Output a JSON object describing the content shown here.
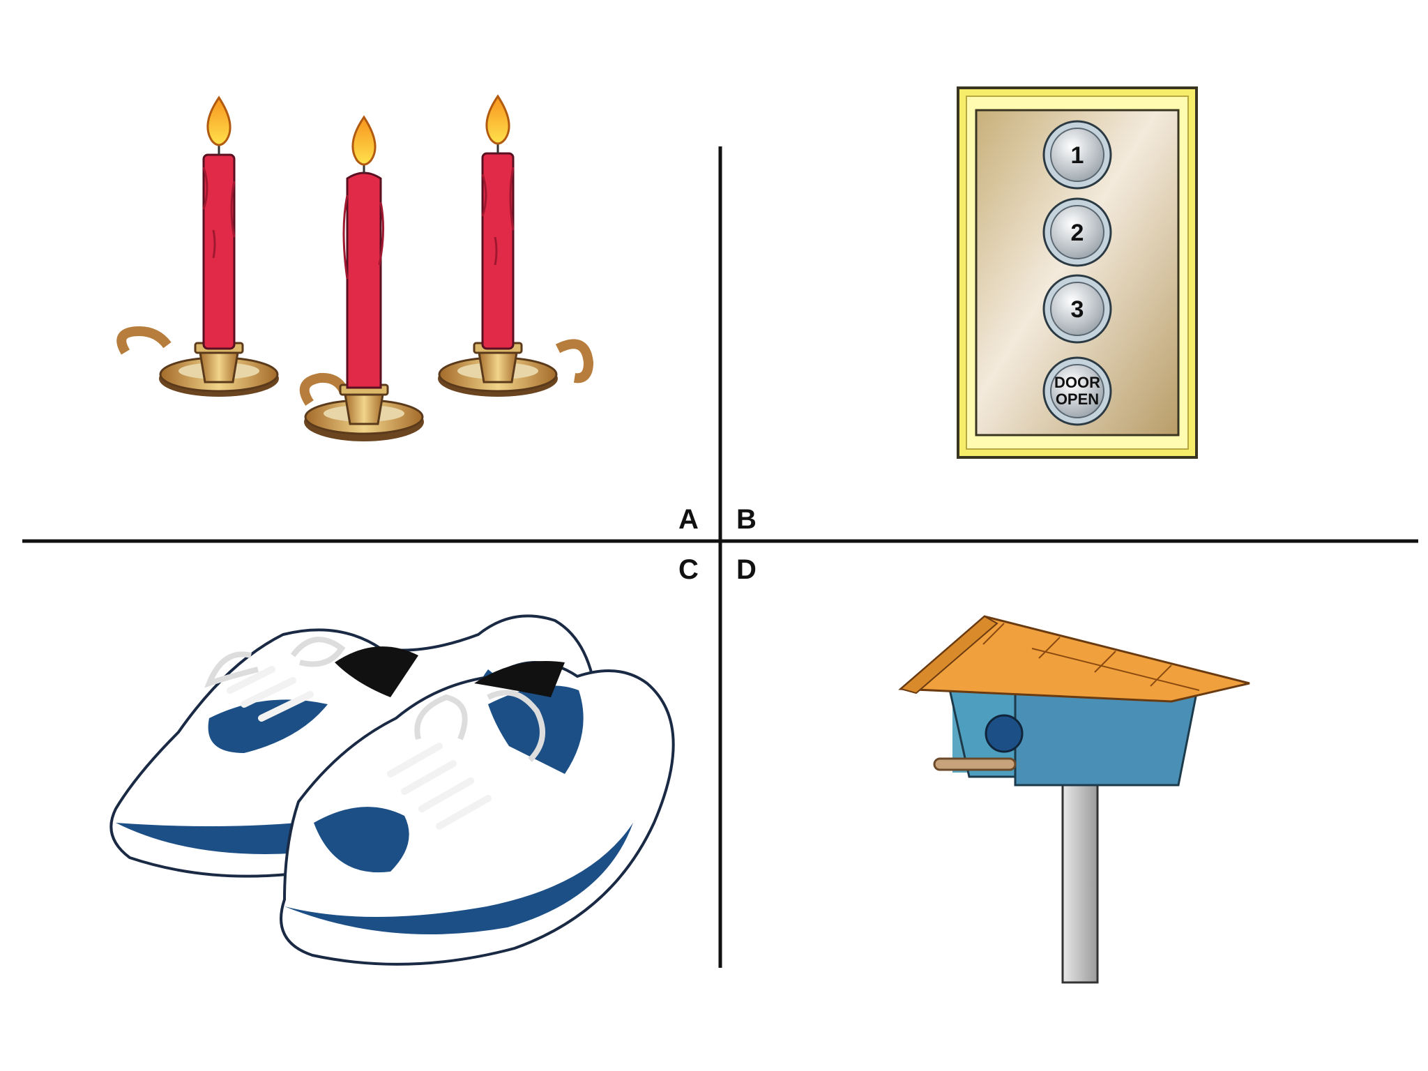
{
  "quadrants": [
    {
      "label": "A",
      "picture": "candles-in-holders"
    },
    {
      "label": "B",
      "picture": "elevator-button-panel"
    },
    {
      "label": "C",
      "picture": "sneakers"
    },
    {
      "label": "D",
      "picture": "birdhouse"
    }
  ],
  "elevator_panel": {
    "buttons": [
      "1",
      "2",
      "3"
    ],
    "door_open_line1": "DOOR",
    "door_open_line2": "OPEN"
  },
  "colors": {
    "divider": "#111111",
    "candle_red": "#e02a48",
    "brass": "#c9a24a",
    "panel_frame": "#f6ee6a",
    "shoe_blue": "#1c4f86",
    "birdhouse_blue": "#4e9fbf",
    "roof_orange": "#f0a03c"
  }
}
